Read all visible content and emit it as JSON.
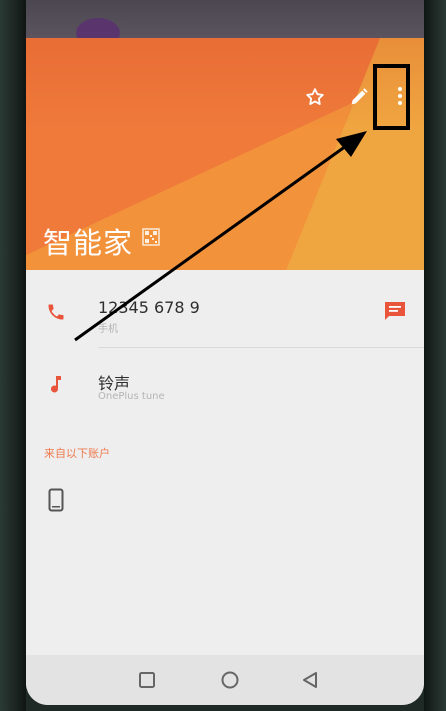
{
  "contact": {
    "name": "智能家",
    "phone_number": "12345 678 9",
    "phone_type": "手机",
    "ringtone_label": "铃声",
    "ringtone_value": "OnePlus tune"
  },
  "accounts_section": {
    "label": "来自以下账户"
  },
  "colors": {
    "header_orange": "#ef7a3a",
    "accent_red": "#e8553a"
  },
  "icons": {
    "favorite": "star-outline-icon",
    "edit": "pencil-icon",
    "more": "more-vert-icon",
    "qr": "qr-code-icon",
    "call": "phone-icon",
    "message": "message-icon",
    "ringtone": "music-note-icon",
    "device": "phone-device-icon",
    "nav_recents": "square-icon",
    "nav_home": "circle-icon",
    "nav_back": "triangle-back-icon"
  }
}
